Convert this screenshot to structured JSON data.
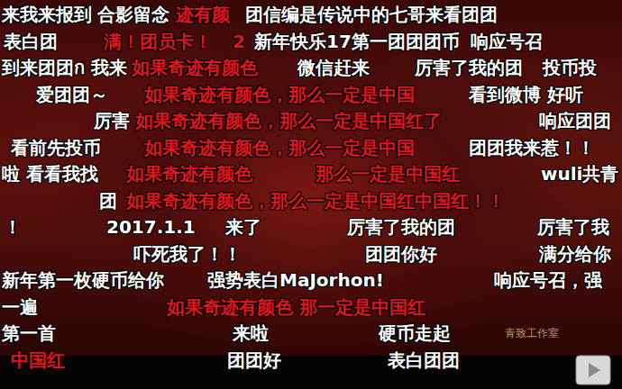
{
  "player": {
    "watermark": "青致工作室"
  },
  "lanes": [
    {
      "comments": [
        {
          "text": "来我来报到",
          "color": "#ffffff"
        },
        {
          "text": "合影留念",
          "color": "#ffffff"
        },
        {
          "text": "迹有颜",
          "color": "#e3151c"
        },
        {
          "text": "团信编是传说中的七哥来看团团",
          "color": "#ffffff"
        }
      ]
    },
    {
      "comments": [
        {
          "text": "表白团",
          "color": "#ffffff"
        },
        {
          "text": "满！团员卡！",
          "color": "#e3151c"
        },
        {
          "text": "2",
          "color": "#e3151c"
        },
        {
          "text": "新年快乐17第一团团团币",
          "color": "#ffffff"
        },
        {
          "text": "响应号召",
          "color": "#ffffff"
        }
      ]
    },
    {
      "comments": [
        {
          "text": "到来团团ก 我来",
          "color": "#ffffff"
        },
        {
          "text": "如果奇迹有颜色",
          "color": "#e3151c"
        },
        {
          "text": "微信赶来",
          "color": "#ffffff"
        },
        {
          "text": "厉害了我的团",
          "color": "#ffffff"
        },
        {
          "text": "投币投",
          "color": "#ffffff"
        }
      ]
    },
    {
      "comments": [
        {
          "text": "爱团团～",
          "color": "#ffffff"
        },
        {
          "text": "如果奇迹有颜色，那么一定是中国",
          "color": "#e3151c"
        },
        {
          "text": "看到微博 好听",
          "color": "#ffffff"
        }
      ]
    },
    {
      "comments": [
        {
          "text": "厉害",
          "color": "#ffffff"
        },
        {
          "text": "如果奇迹有颜色，那么一定是中国红了",
          "color": "#e3151c"
        },
        {
          "text": "响应团团",
          "color": "#ffffff"
        }
      ]
    },
    {
      "comments": [
        {
          "text": "看前先投币",
          "color": "#ffffff"
        },
        {
          "text": "如果奇迹有颜色，那么一定是中国",
          "color": "#e3151c"
        },
        {
          "text": "团团我来惹！！",
          "color": "#ffffff"
        }
      ]
    },
    {
      "comments": [
        {
          "text": "啦 看看我找",
          "color": "#ffffff"
        },
        {
          "text": "如果奇迹有颜色",
          "color": "#e3151c"
        },
        {
          "text": "那么一定是中国红",
          "color": "#e3151c"
        },
        {
          "text": "wuli共青",
          "color": "#ffffff"
        }
      ]
    },
    {
      "comments": [
        {
          "text": "团",
          "color": "#ffffff"
        },
        {
          "text": "如果奇迹有颜色，那么一定是中国红中国红！！",
          "color": "#e3151c"
        }
      ]
    },
    {
      "comments": [
        {
          "text": "！",
          "color": "#ffffff"
        },
        {
          "text": "2017.1.1",
          "color": "#ffffff"
        },
        {
          "text": "来了",
          "color": "#ffffff"
        },
        {
          "text": "厉害了我的团",
          "color": "#ffffff"
        },
        {
          "text": "厉害了我",
          "color": "#ffffff"
        }
      ]
    },
    {
      "comments": [
        {
          "text": "吓死我了！！",
          "color": "#ffffff"
        },
        {
          "text": "团团你好",
          "color": "#ffffff"
        },
        {
          "text": "满分给你",
          "color": "#ffffff"
        }
      ]
    },
    {
      "comments": [
        {
          "text": "新年第一枚硬币给你",
          "color": "#ffffff"
        },
        {
          "text": "强势表白MaJorhon!",
          "color": "#ffffff"
        },
        {
          "text": "响应号召，强",
          "color": "#ffffff"
        }
      ]
    },
    {
      "comments": [
        {
          "text": "一遍",
          "color": "#ffffff"
        },
        {
          "text": "如果奇迹有颜色  那一定是中国红",
          "color": "#e3151c"
        }
      ]
    },
    {
      "comments": [
        {
          "text": "第一首",
          "color": "#ffffff"
        },
        {
          "text": "来啦",
          "color": "#ffffff"
        },
        {
          "text": "硬币走起",
          "color": "#ffffff"
        }
      ]
    },
    {
      "comments": [
        {
          "text": "中国红",
          "color": "#e3151c"
        },
        {
          "text": "团团好",
          "color": "#ffffff"
        },
        {
          "text": "表白团团",
          "color": "#ffffff"
        }
      ]
    }
  ]
}
